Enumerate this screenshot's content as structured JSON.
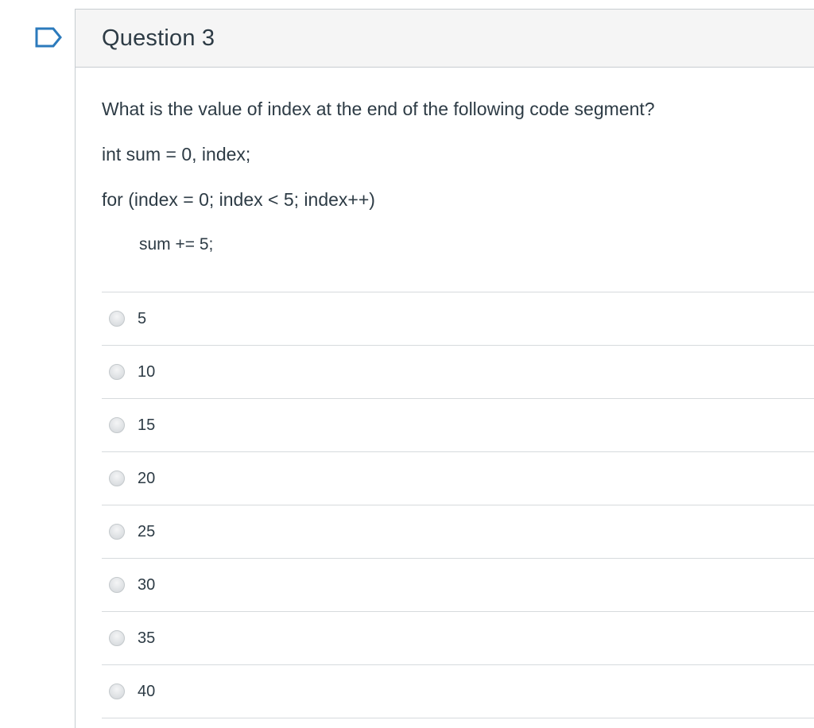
{
  "question": {
    "title": "Question 3",
    "prompt": "What is the value of index at the end of the following code segment?",
    "code_lines": [
      "int sum = 0, index;",
      "for (index = 0; index < 5; index++)",
      "sum += 5;"
    ],
    "answers": [
      "5",
      "10",
      "15",
      "20",
      "25",
      "30",
      "35",
      "40"
    ]
  },
  "icons": {
    "flag": "bookmark-flag-icon"
  },
  "colors": {
    "flag_border": "#2b7abc",
    "header_bg": "#f5f5f5",
    "text": "#2d3b45"
  }
}
